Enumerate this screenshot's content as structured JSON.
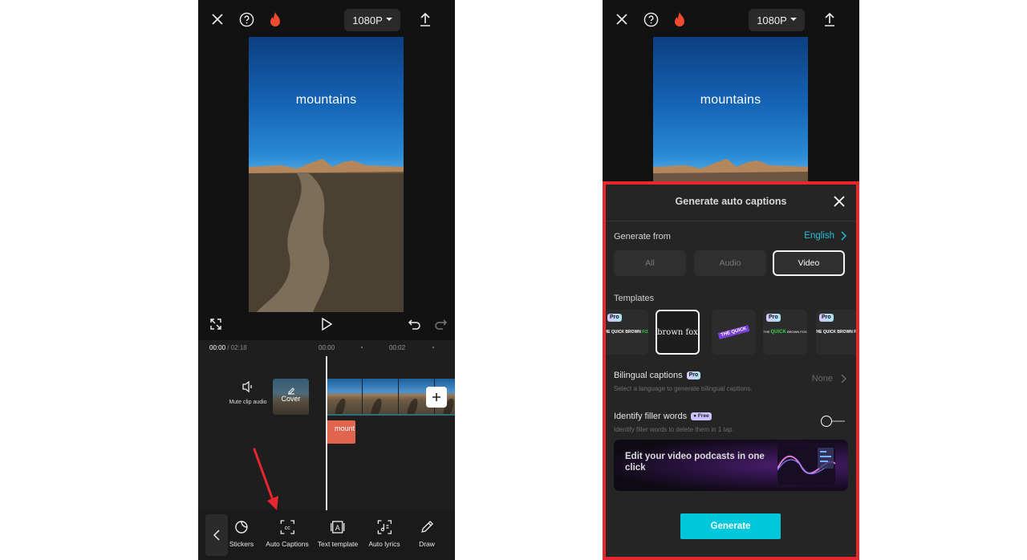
{
  "topbar": {
    "resolution": "1080P",
    "icons": [
      "close-icon",
      "help-icon",
      "fire-icon",
      "export-icon"
    ]
  },
  "preview": {
    "caption_text": "mountains"
  },
  "timeline": {
    "current_time": "00:00",
    "total_time": " / 02:18",
    "ticks": [
      "00:00",
      "00:02"
    ],
    "mute_label": "Mute clip audio",
    "cover_label": "Cover",
    "text_clip_label": "mount"
  },
  "toolbar": {
    "items": [
      {
        "label": "Stickers",
        "icon": "sticker-icon"
      },
      {
        "label": "Auto Captions",
        "icon": "cc-icon"
      },
      {
        "label": "Text template",
        "icon": "text-template-icon"
      },
      {
        "label": "Auto lyrics",
        "icon": "lyrics-icon"
      },
      {
        "label": "Draw",
        "icon": "pencil-icon"
      }
    ]
  },
  "annotation": {
    "arrow_color": "#e8262d",
    "highlight_color": "#e8262d"
  },
  "sheet": {
    "title": "Generate auto captions",
    "generate_from_label": "Generate from",
    "language": "English",
    "sources": [
      {
        "label": "All",
        "selected": false
      },
      {
        "label": "Audio",
        "selected": false
      },
      {
        "label": "Video",
        "selected": true
      }
    ],
    "templates_label": "Templates",
    "templates": [
      {
        "text": "THE QUICK BROWN FOX",
        "pro": true
      },
      {
        "text": "brown fox",
        "pro": false,
        "selected": true
      },
      {
        "text": "THE QUICK",
        "pro": false
      },
      {
        "text": "THE QUICK BROWN FOX",
        "pro": true
      },
      {
        "text": "THE QUICK BROWN FOX",
        "pro": true
      }
    ],
    "pro_badge": "Pro",
    "free_badge": "Free",
    "bilingual_title": "Bilingual captions",
    "bilingual_sub": "Select a language to generate bilingual captions.",
    "bilingual_value": "None",
    "filler_title": "Identify filler words",
    "filler_sub": "Identify filler words to delete them in 1 tap.",
    "filler_enabled": false,
    "promo_text": "Edit your video podcasts in one click",
    "generate_label": "Generate",
    "accent_color": "#00c8dc",
    "link_color": "#20c1d8"
  }
}
